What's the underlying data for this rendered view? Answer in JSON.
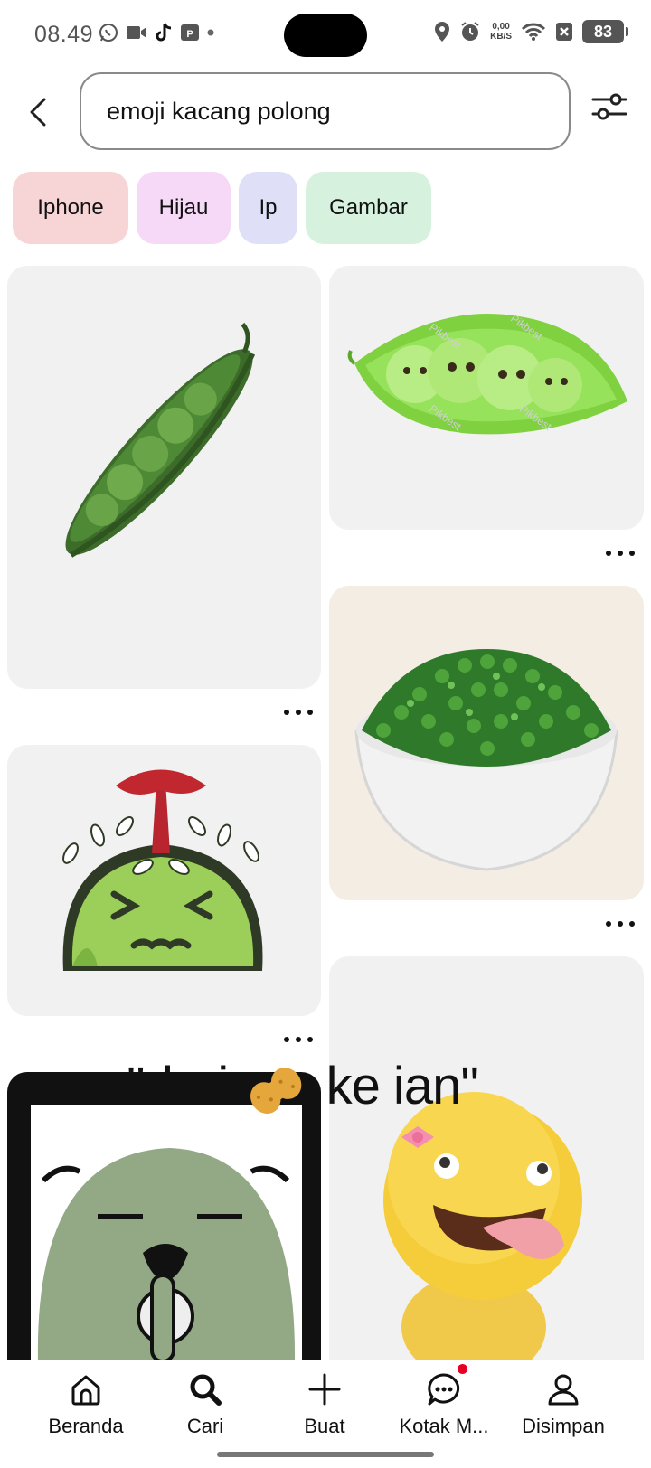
{
  "status_bar": {
    "time": "08.49",
    "net_speed_value": "0,00",
    "net_speed_unit": "KB/S",
    "battery": "83"
  },
  "search": {
    "query": "emoji kacang polong"
  },
  "chips": [
    {
      "label": "Iphone",
      "color": "#f7d4d6"
    },
    {
      "label": "Hijau",
      "color": "#f6d9f6"
    },
    {
      "label": "Ip",
      "color": "#dfe0f8"
    },
    {
      "label": "Gambar",
      "color": "#d6f2df"
    }
  ],
  "overlay_text": {
    "part1": "\"dari",
    "part2": "ke ian\""
  },
  "watermark": "Pikbest",
  "nav": [
    {
      "label": "Beranda",
      "icon": "home-icon"
    },
    {
      "label": "Cari",
      "icon": "search-icon"
    },
    {
      "label": "Buat",
      "icon": "plus-icon"
    },
    {
      "label": "Kotak M...",
      "icon": "chat-icon"
    },
    {
      "label": "Disimpan",
      "icon": "user-icon"
    }
  ]
}
